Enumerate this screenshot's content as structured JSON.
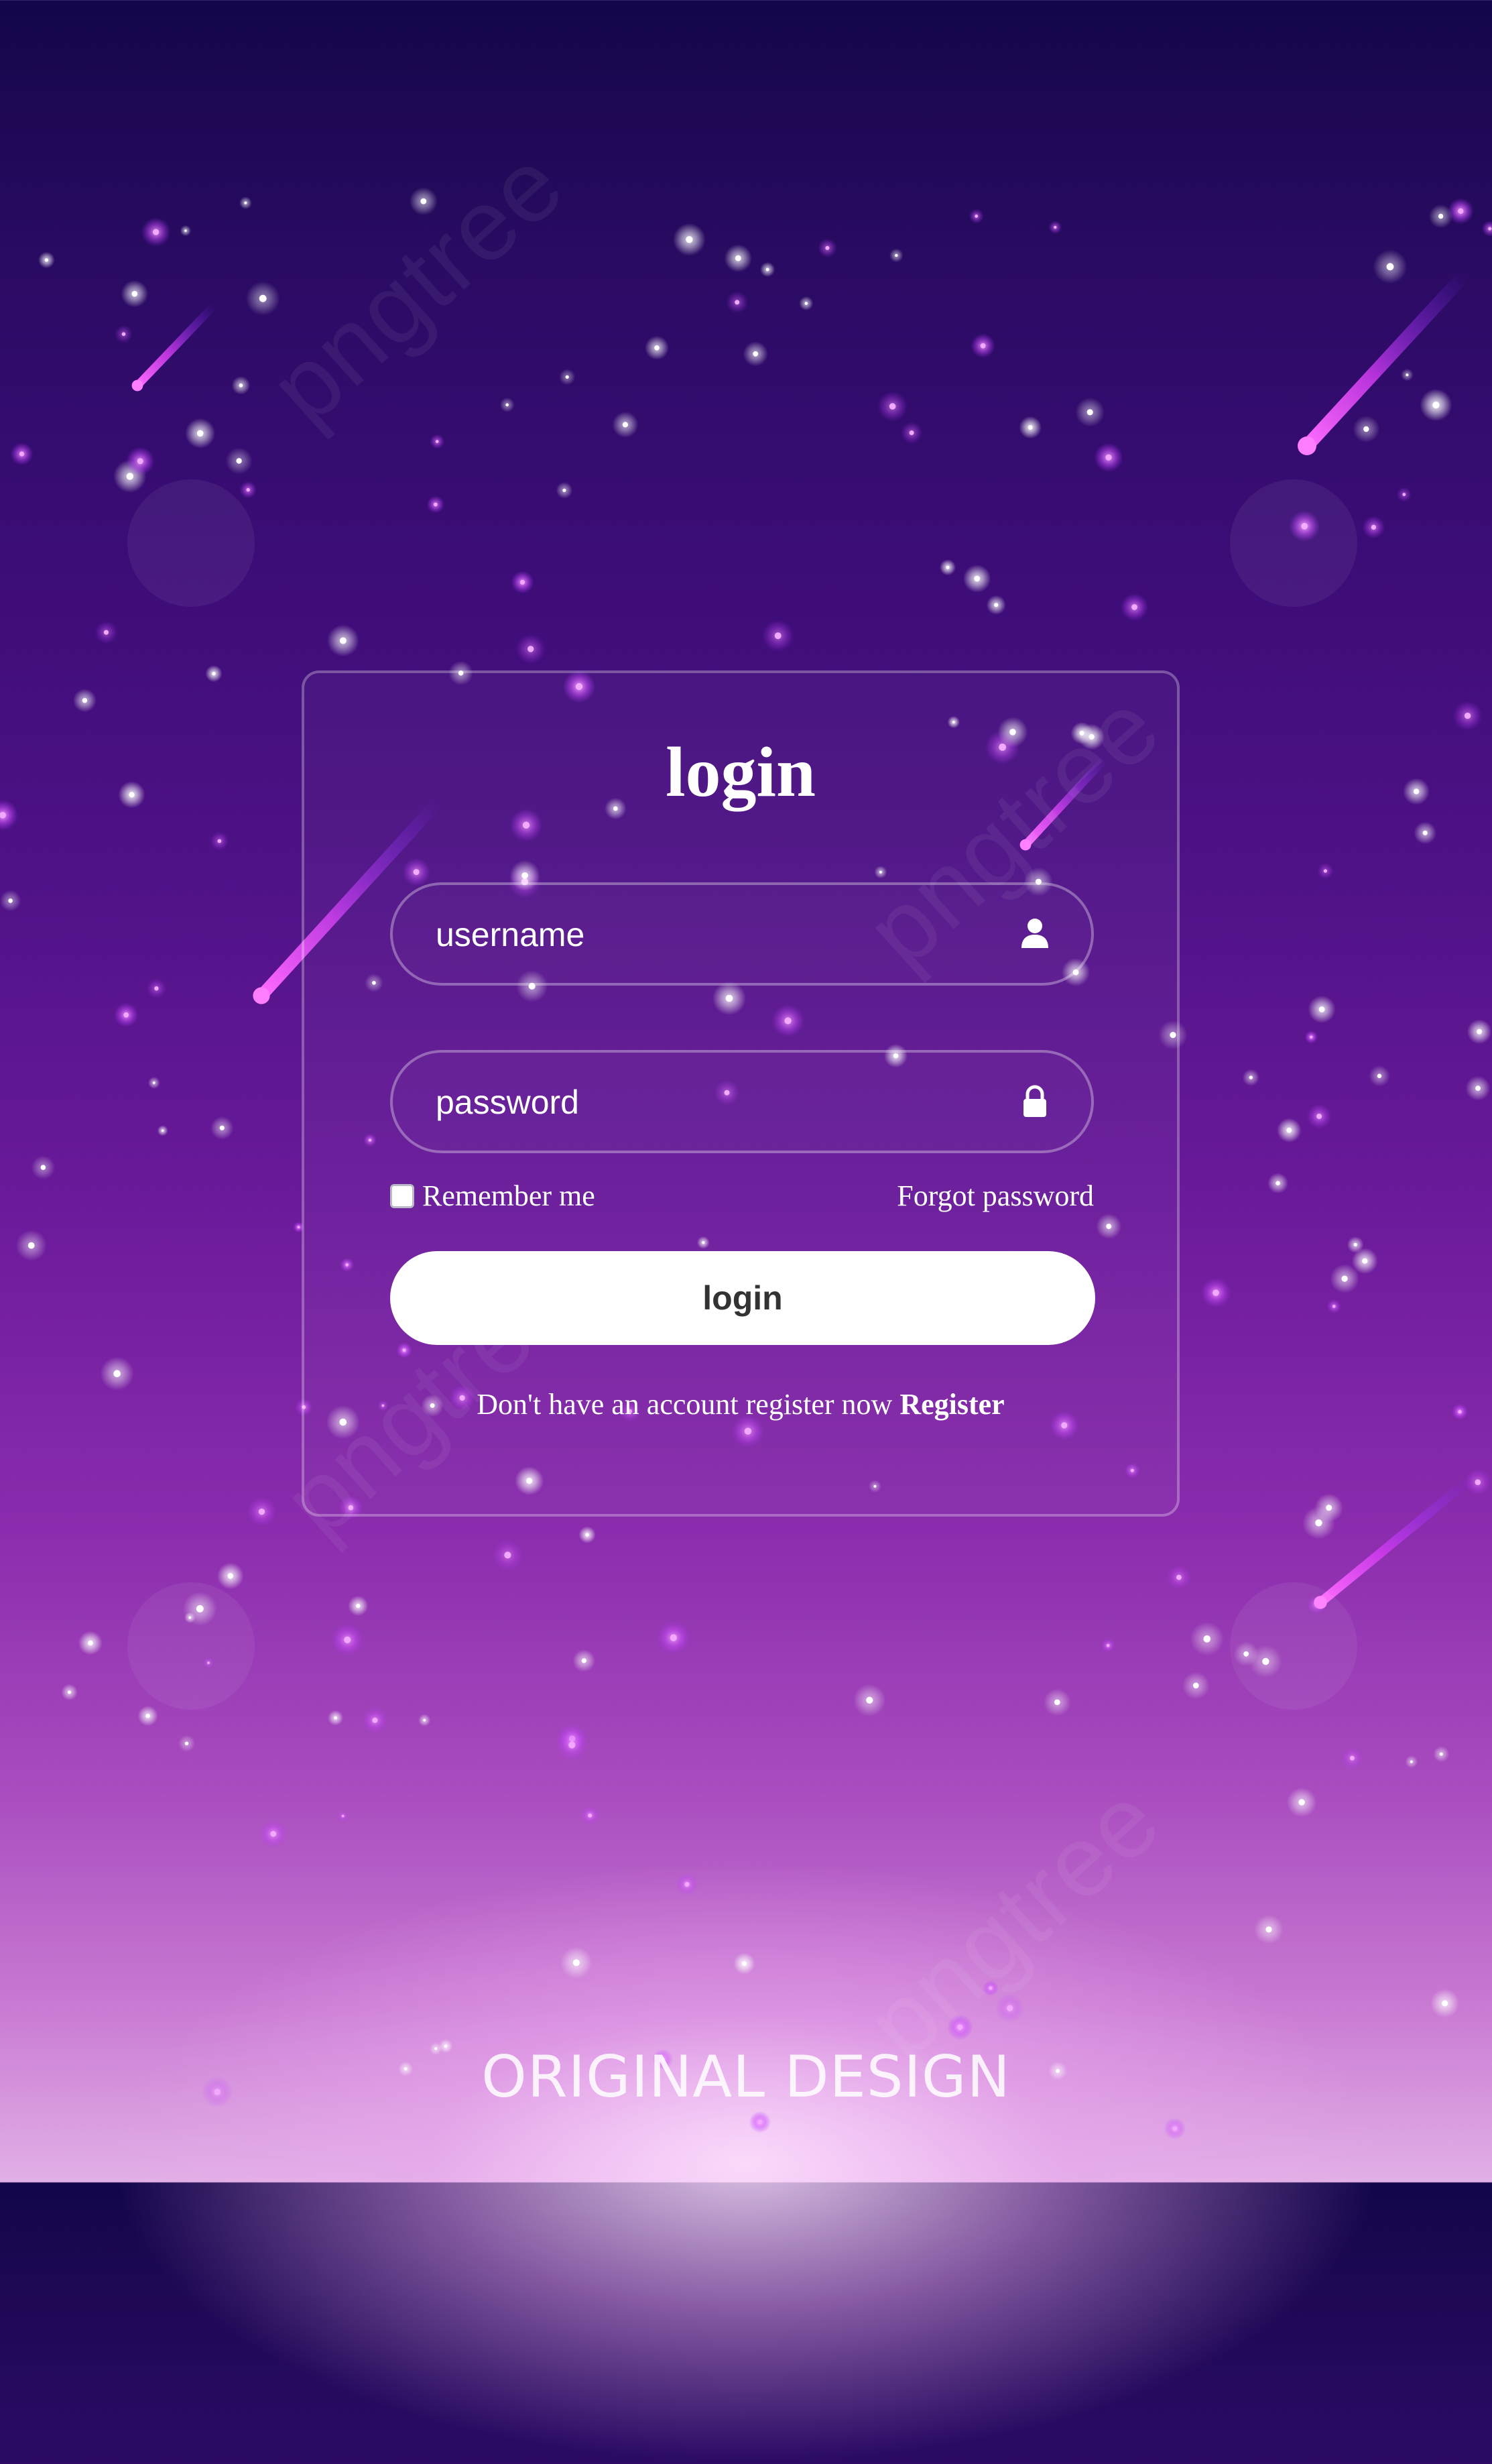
{
  "card": {
    "title": "login"
  },
  "username": {
    "placeholder": "username",
    "icon": "user-icon"
  },
  "password": {
    "placeholder": "password",
    "icon": "lock-icon"
  },
  "options": {
    "remember_label": "Remember me",
    "remember_checked": false,
    "forgot_label": "Forgot password"
  },
  "login_button": {
    "label": "login"
  },
  "register": {
    "prompt": "Don't have an account register now ",
    "link_label": "Register"
  },
  "footer": {
    "caption": "ORIGINAL DESIGN"
  },
  "watermark": {
    "text": "pngtree"
  },
  "colors": {
    "background_top": "#14064a",
    "background_mid": "#6a1a9a",
    "background_bottom": "#e2b0e6",
    "meteor": "#e040fb",
    "text": "#ffffff",
    "button_bg": "#ffffff",
    "button_text": "#333333"
  }
}
